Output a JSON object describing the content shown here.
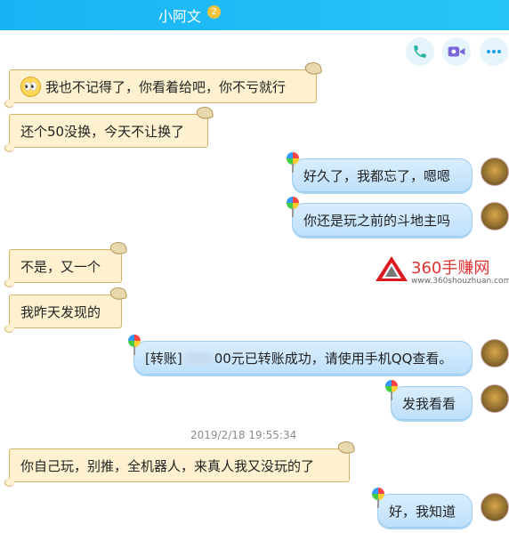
{
  "header": {
    "title": "小阿文",
    "badge": "2"
  },
  "actions": {
    "phone": "phone-icon",
    "video": "video-icon",
    "more": "more-icon"
  },
  "messages": [
    {
      "side": "left",
      "text": "我也不记得了，你看着给吧，你不亏就行",
      "emoji": "👀"
    },
    {
      "side": "left",
      "text": "还个50没换，今天不让换了"
    },
    {
      "side": "right",
      "text": "好久了，我都忘了，嗯嗯"
    },
    {
      "side": "right",
      "text": "你还是玩之前的斗地主吗"
    },
    {
      "side": "left",
      "text": "不是，又一个"
    },
    {
      "side": "left",
      "text": "我昨天发现的"
    },
    {
      "side": "right",
      "prefix": "[转账]",
      "suffix": "00元已转账成功，请使用手机QQ查看。"
    },
    {
      "side": "right",
      "text": "发我看看"
    },
    {
      "side": "left",
      "text": "你自己玩，别推，全机器人，来真人我又没玩的了"
    },
    {
      "side": "right",
      "text": "好，我知道"
    }
  ],
  "timestamp": "2019/2/18 19:55:34",
  "watermark": {
    "brand": "360手赚网",
    "url": "www.360shouzhuan.com"
  },
  "colors": {
    "header": "#19b2f5",
    "left_bubble": "#fdf1cf",
    "right_bubble": "#cde7fc"
  }
}
